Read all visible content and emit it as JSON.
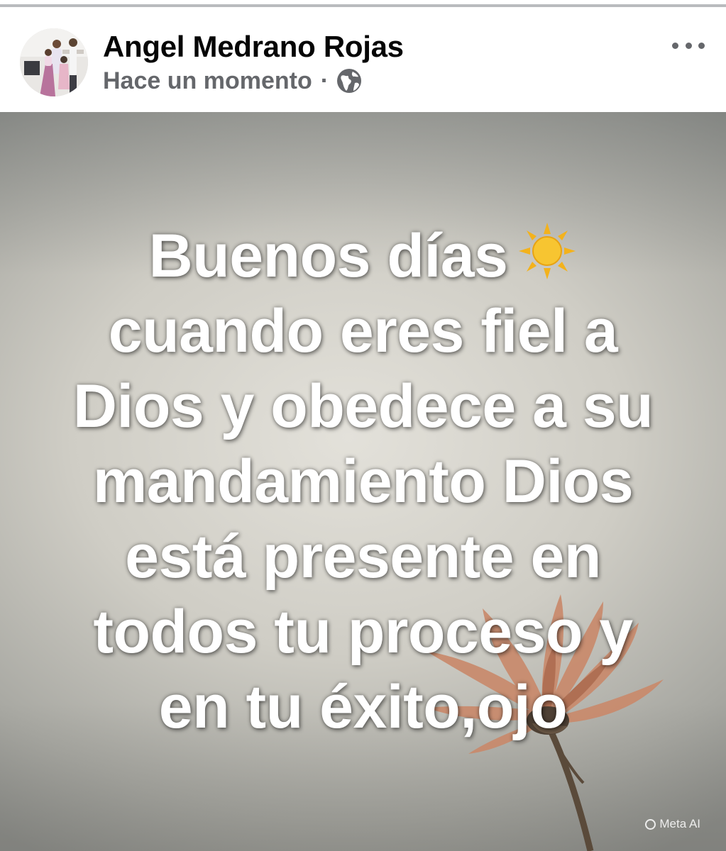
{
  "post": {
    "author": "Angel Medrano Rojas",
    "timestamp": "Hace un momento",
    "separator": "·",
    "audience_icon": "globe-icon",
    "more_icon": "more-horizontal-icon"
  },
  "image": {
    "quote_lines": [
      "Buenos días",
      "cuando eres fiel a",
      "Dios y obedece a su",
      "mandamiento Dios",
      "está presente en",
      "todos tu proceso y",
      "en tu éxito,ojo"
    ],
    "sun_icon": "sun-emoji-icon",
    "watermark": "Meta AI"
  },
  "colors": {
    "author_text": "#050505",
    "meta_text": "#65676b",
    "quote_text": "#ffffff",
    "image_background": "#cfcdc5",
    "flower": "#c98a6c"
  }
}
